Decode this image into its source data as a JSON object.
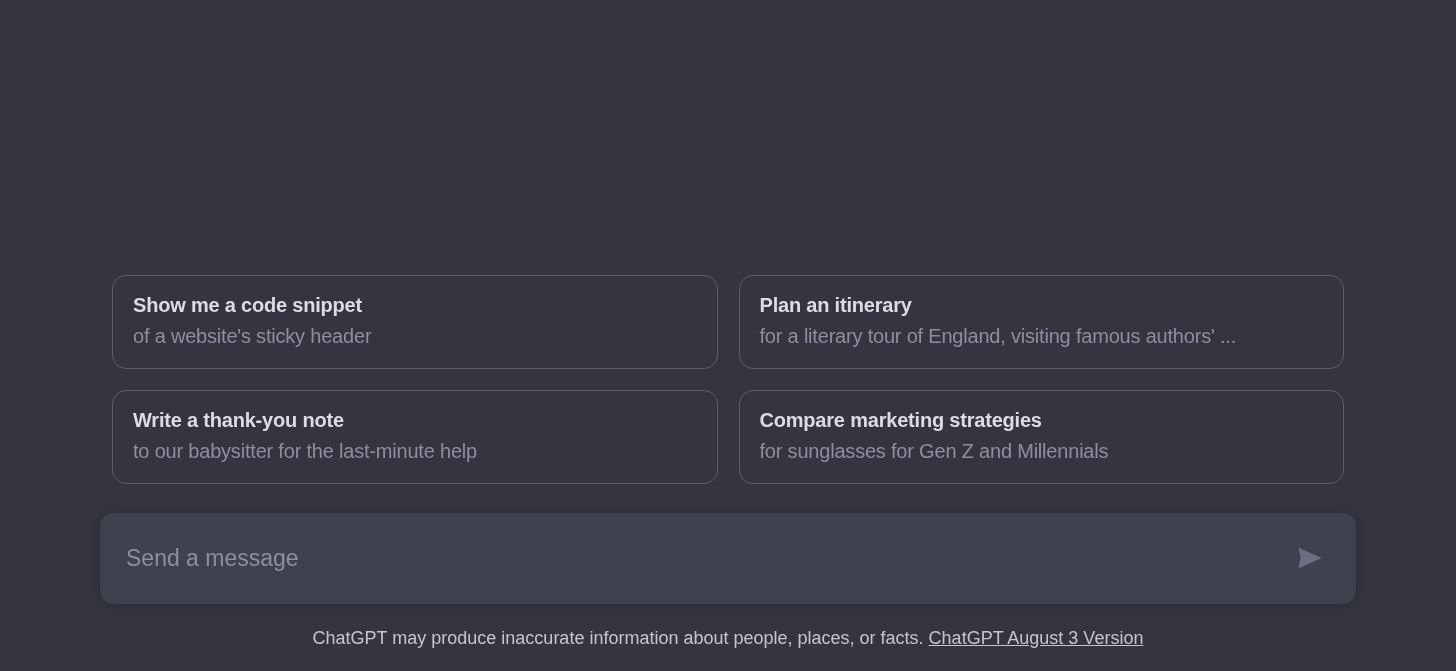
{
  "suggestions": [
    {
      "title": "Show me a code snippet",
      "subtitle": "of a website's sticky header"
    },
    {
      "title": "Plan an itinerary",
      "subtitle": "for a literary tour of England, visiting famous authors' ..."
    },
    {
      "title": "Write a thank-you note",
      "subtitle": "to our babysitter for the last-minute help"
    },
    {
      "title": "Compare marketing strategies",
      "subtitle": "for sunglasses for Gen Z and Millennials"
    }
  ],
  "composer": {
    "placeholder": "Send a message"
  },
  "footer": {
    "text": "ChatGPT may produce inaccurate information about people, places, or facts.",
    "link": "ChatGPT August 3 Version"
  }
}
